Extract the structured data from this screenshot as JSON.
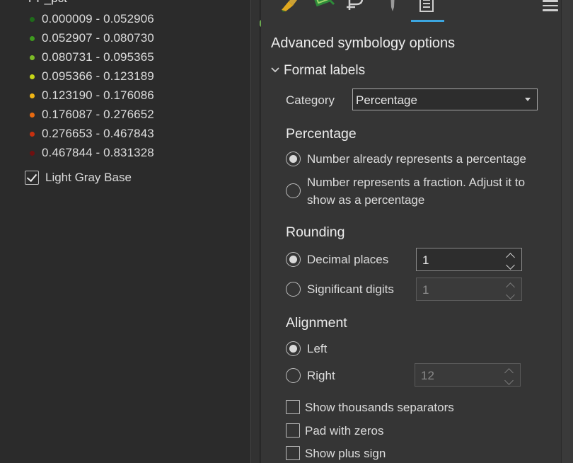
{
  "contents": {
    "layer_title": "PP_pct",
    "legend": [
      {
        "label": "0.000009 - 0.052906",
        "color": "#1f6b1a"
      },
      {
        "label": "0.052907 - 0.080730",
        "color": "#3f9a1f"
      },
      {
        "label": "0.080731 - 0.095365",
        "color": "#7dbb27"
      },
      {
        "label": "0.095366 - 0.123189",
        "color": "#c6d617"
      },
      {
        "label": "0.123190 - 0.176086",
        "color": "#f0b515"
      },
      {
        "label": "0.176087 - 0.276652",
        "color": "#e86a10"
      },
      {
        "label": "0.276653 - 0.467843",
        "color": "#c7300f"
      },
      {
        "label": "0.467844 - 0.831328",
        "color": "#6e1010"
      }
    ],
    "base_layer": {
      "label": "Light Gray Base",
      "checked": true
    }
  },
  "panel": {
    "toolbar_icons": [
      "paintbrush-icon",
      "vary-symbology-icon",
      "label-text-icon",
      "pin-icon",
      "advanced-options-icon"
    ],
    "title": "Advanced symbology options",
    "format_labels": {
      "header": "Format labels",
      "category_label": "Category",
      "category_value": "Percentage",
      "percentage": {
        "heading": "Percentage",
        "option_already": "Number already represents a percentage",
        "option_fraction_line1": "Number represents a fraction. Adjust it to",
        "option_fraction_line2": "show as a percentage",
        "selected": "already"
      },
      "rounding": {
        "heading": "Rounding",
        "decimal_label": "Decimal places",
        "decimal_value": "1",
        "significant_label": "Significant digits",
        "significant_value": "1",
        "selected": "decimal"
      },
      "alignment": {
        "heading": "Alignment",
        "left_label": "Left",
        "right_label": "Right",
        "right_value": "12",
        "selected": "left"
      },
      "show_thousands": "Show thousands separators",
      "pad_zeros": "Pad with zeros",
      "show_plus": "Show plus sign"
    }
  },
  "colors": {
    "accent": "#3ca6e0"
  }
}
